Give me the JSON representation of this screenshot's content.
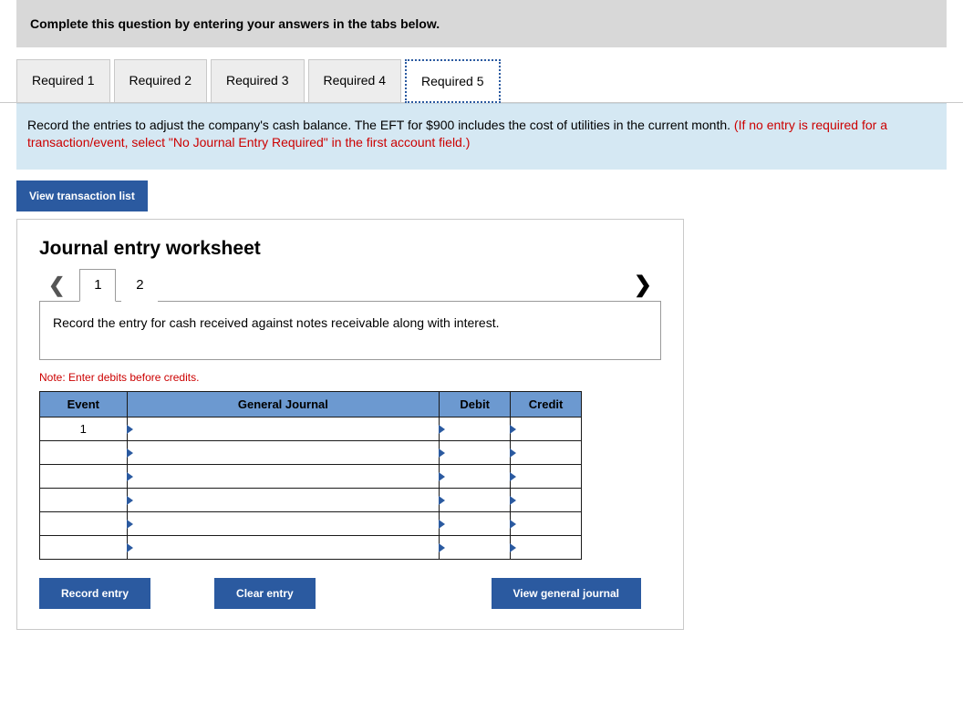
{
  "instruction": "Complete this question by entering your answers in the tabs below.",
  "tabs": [
    {
      "label": "Required 1"
    },
    {
      "label": "Required 2"
    },
    {
      "label": "Required 3"
    },
    {
      "label": "Required 4"
    },
    {
      "label": "Required 5"
    }
  ],
  "active_tab_index": 4,
  "prompt": {
    "main": "Record the entries to adjust the company's cash balance. The EFT for $900 includes the cost of utilities in the current month. ",
    "warn": "(If no entry is required for a transaction/event, select \"No Journal Entry Required\" in the first account field.)"
  },
  "buttons": {
    "view_transaction_list": "View transaction list",
    "record_entry": "Record entry",
    "clear_entry": "Clear entry",
    "view_general_journal": "View general journal"
  },
  "worksheet": {
    "title": "Journal entry worksheet",
    "pages": [
      "1",
      "2"
    ],
    "active_page_index": 0,
    "entry_desc": "Record the entry for cash received against notes receivable along with interest.",
    "note": "Note: Enter debits before credits.",
    "headers": {
      "event": "Event",
      "gj": "General Journal",
      "debit": "Debit",
      "credit": "Credit"
    },
    "rows": [
      {
        "event": "1",
        "gj": "",
        "debit": "",
        "credit": ""
      },
      {
        "event": "",
        "gj": "",
        "debit": "",
        "credit": ""
      },
      {
        "event": "",
        "gj": "",
        "debit": "",
        "credit": ""
      },
      {
        "event": "",
        "gj": "",
        "debit": "",
        "credit": ""
      },
      {
        "event": "",
        "gj": "",
        "debit": "",
        "credit": ""
      },
      {
        "event": "",
        "gj": "",
        "debit": "",
        "credit": ""
      }
    ]
  }
}
